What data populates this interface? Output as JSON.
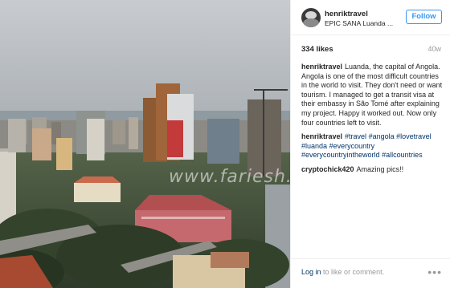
{
  "photo": {
    "alt": "",
    "watermark": "www.fariesh.com"
  },
  "header": {
    "username": "henriktravel",
    "location": "EPIC SANA Luanda ...",
    "follow_label": "Follow"
  },
  "stats": {
    "likes": "334 likes",
    "age": "40w"
  },
  "comments": [
    {
      "author": "henriktravel",
      "text": "Luanda, the capital of Angola. Angola is one of the most difficult countries in the world to visit. They don't need or want tourism. I managed to get a transit visa at their embassy in São Tomé after explaining my project. Happy it worked out. Now only four countries left to visit."
    },
    {
      "author": "henriktravel",
      "tags": [
        "#travel",
        "#angola",
        "#lovetravel",
        "#luanda",
        "#everycountry",
        "#everycountryintheworld",
        "#allcountries"
      ]
    },
    {
      "author": "cryptochick420",
      "text": "Amazing pics!!"
    }
  ],
  "footer": {
    "login_link": "Log in",
    "login_rest": "to like or comment.",
    "more_icon": "ellipsis-icon"
  },
  "colors": {
    "accent": "#3897f0",
    "link": "#003569",
    "muted": "#999999",
    "text": "#262626"
  }
}
